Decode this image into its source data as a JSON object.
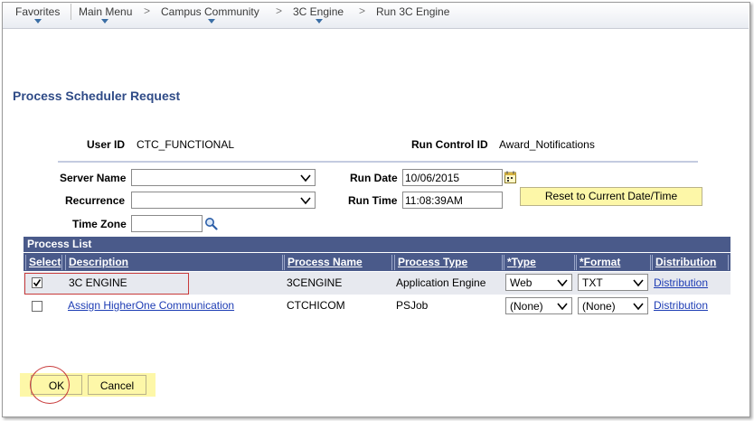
{
  "breadcrumb": {
    "items": [
      "Favorites",
      "Main Menu",
      "Campus Community",
      "3C Engine",
      "Run 3C Engine"
    ],
    "separator": ">"
  },
  "page": {
    "title": "Process Scheduler Request"
  },
  "header": {
    "user_id_label": "User ID",
    "user_id_value": "CTC_FUNCTIONAL",
    "run_control_label": "Run Control ID",
    "run_control_value": "Award_Notifications"
  },
  "form": {
    "server_name_label": "Server Name",
    "server_name_value": "",
    "recurrence_label": "Recurrence",
    "recurrence_value": "",
    "time_zone_label": "Time Zone",
    "time_zone_value": "",
    "run_date_label": "Run Date",
    "run_date_value": "10/06/2015",
    "run_time_label": "Run Time",
    "run_time_value": "11:08:39AM",
    "reset_button": "Reset to Current Date/Time"
  },
  "process_list": {
    "title": "Process List",
    "columns": [
      "Select",
      "Description",
      "Process Name",
      "Process Type",
      "*Type",
      "*Format",
      "Distribution"
    ],
    "rows": [
      {
        "selected": true,
        "description": "3C ENGINE",
        "description_is_link": false,
        "process_name": "3CENGINE",
        "process_type": "Application Engine",
        "type": "Web",
        "format": "TXT",
        "distribution": "Distribution"
      },
      {
        "selected": false,
        "description": "Assign HigherOne Communication",
        "description_is_link": true,
        "process_name": "CTCHICOM",
        "process_type": "PSJob",
        "type": "(None)",
        "format": "(None)",
        "distribution": "Distribution"
      }
    ]
  },
  "buttons": {
    "ok": "OK",
    "cancel": "Cancel"
  },
  "colors": {
    "title": "#2f4b87",
    "grid_header": "#4a5a8a",
    "link": "#1d3cb4",
    "button_bg": "#fdf7a8",
    "highlight": "#c83a3a"
  },
  "icons": {
    "calendar": "calendar-icon",
    "lookup": "magnifier-icon",
    "dropdown": "chevron-down-icon",
    "checkmark": "checkmark-icon"
  }
}
